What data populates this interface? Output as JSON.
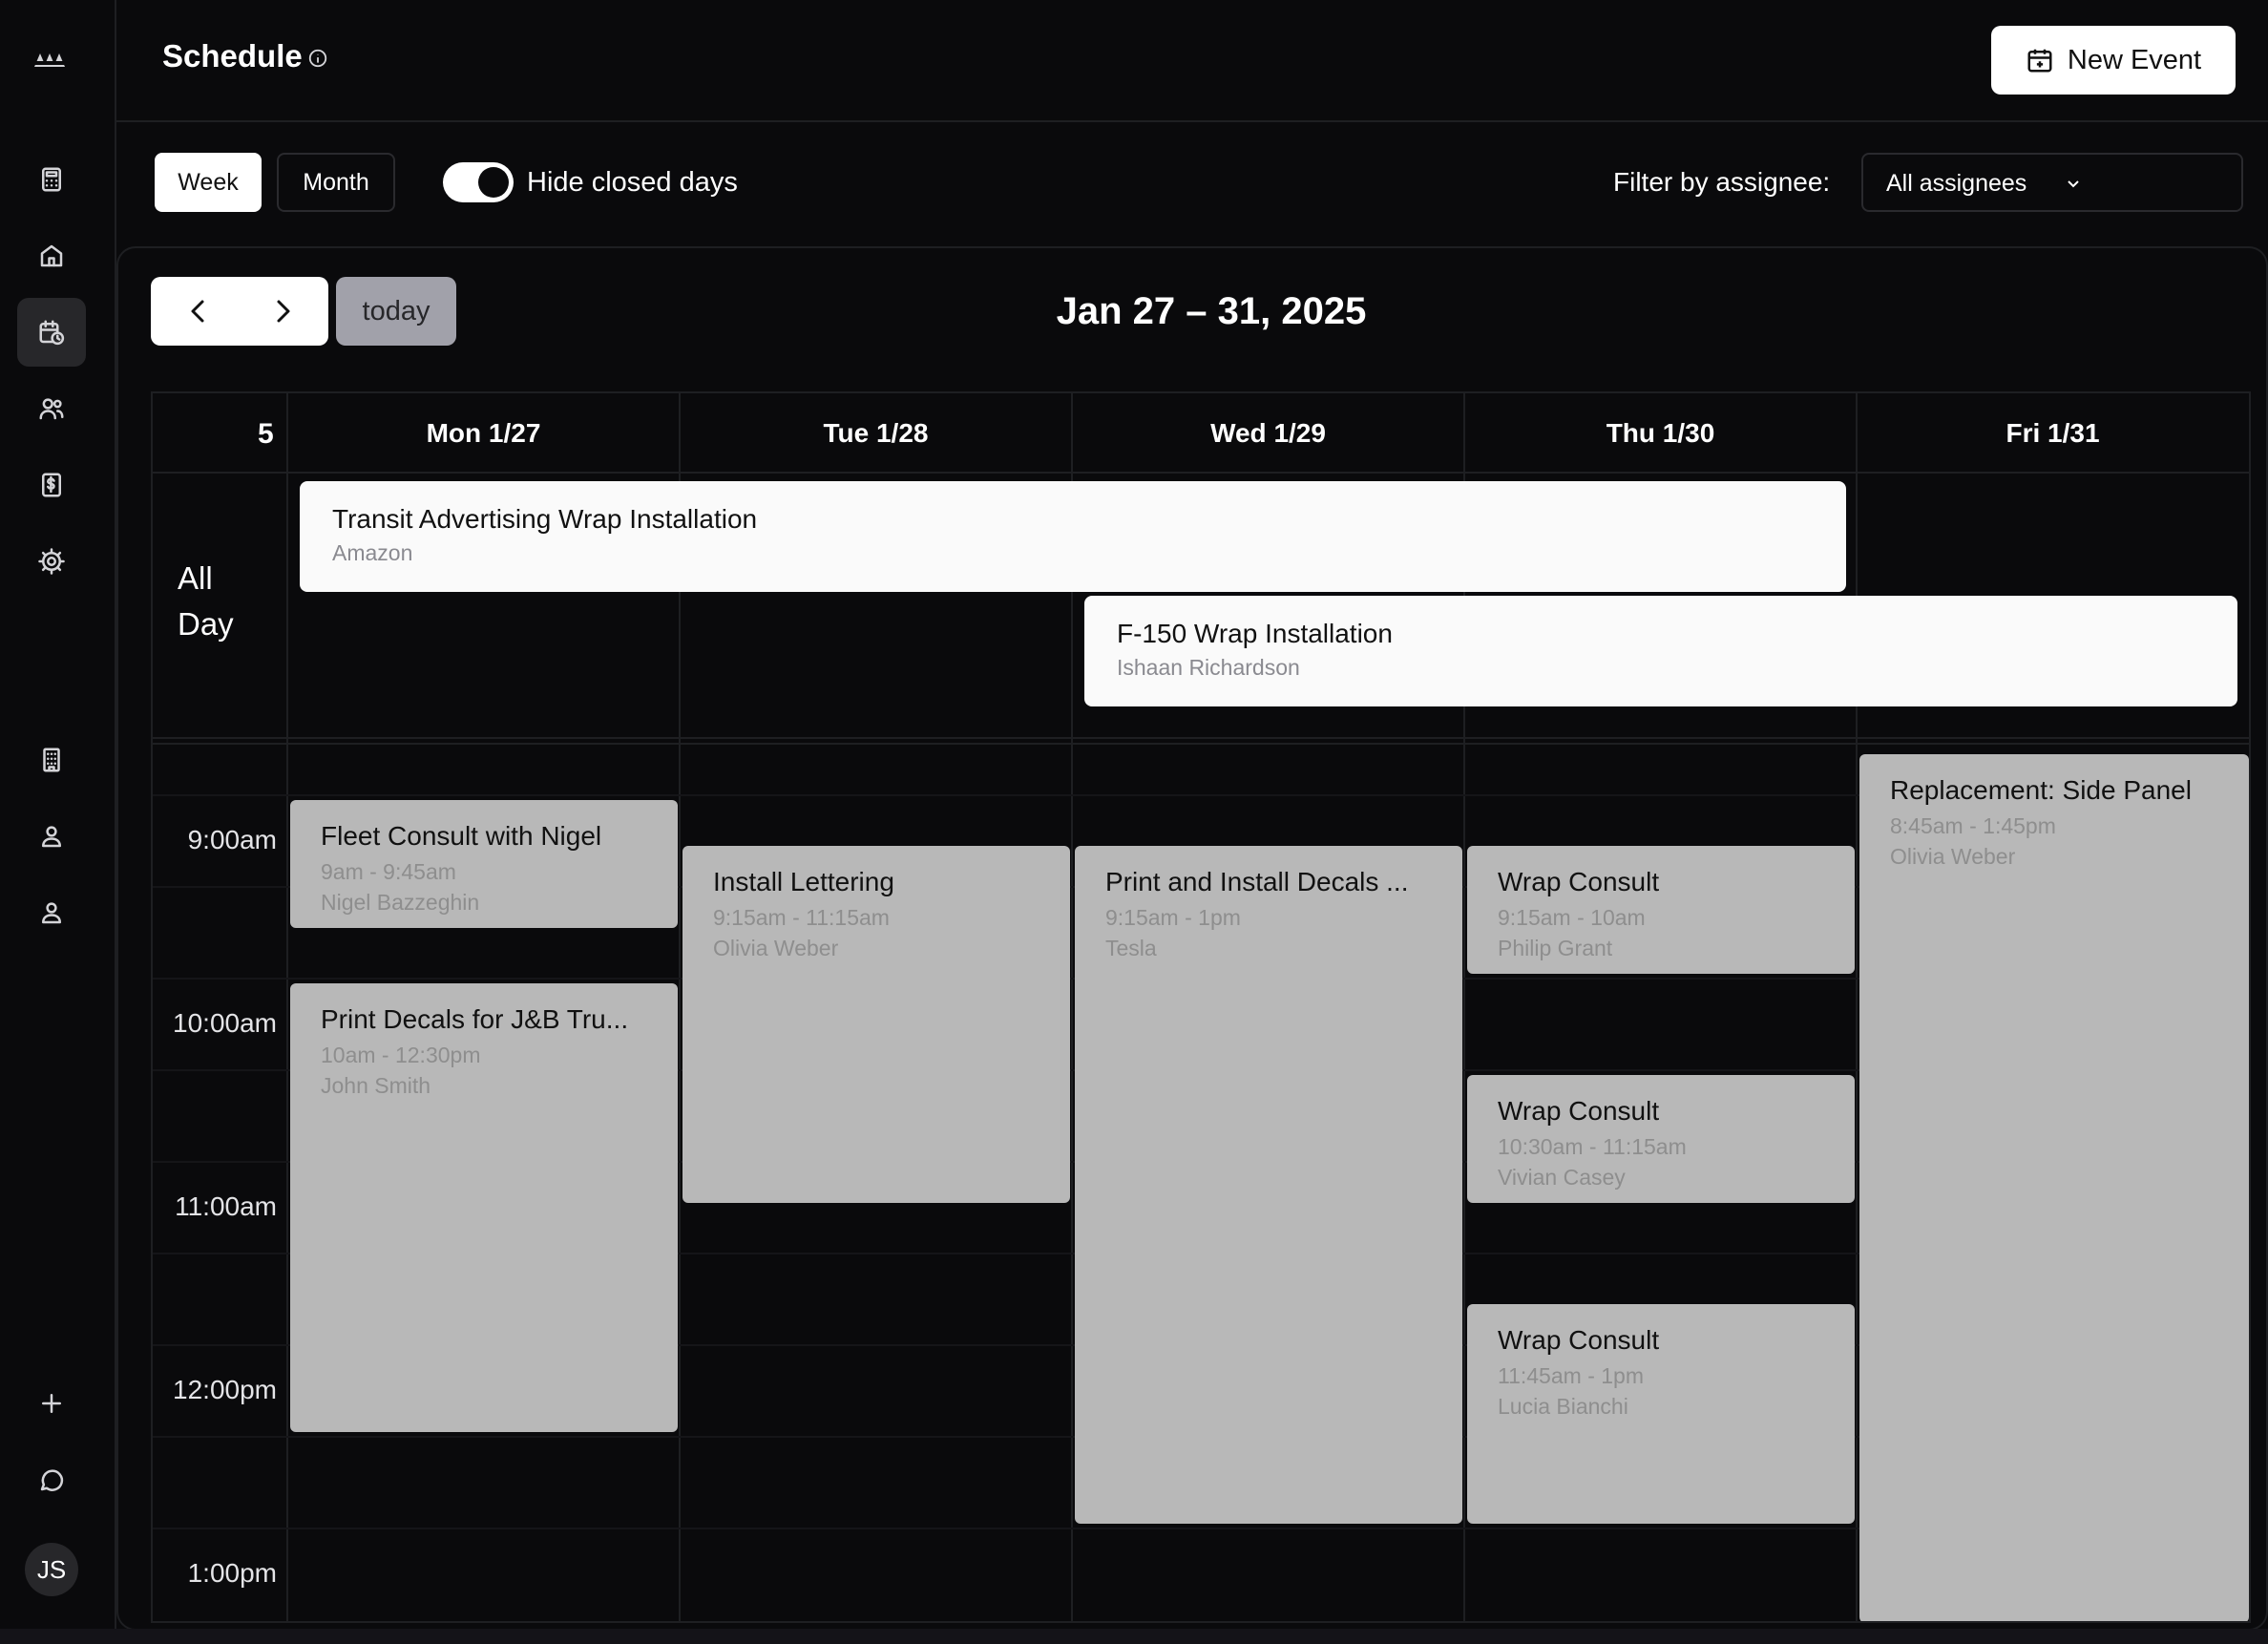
{
  "header": {
    "title": "Schedule",
    "new_event_label": "New Event"
  },
  "sidebar": {
    "items": [
      {
        "name": "calculator-icon"
      },
      {
        "name": "home-icon"
      },
      {
        "name": "calendar-clock-icon",
        "active": true
      },
      {
        "name": "users-icon"
      },
      {
        "name": "invoice-icon"
      },
      {
        "name": "settings-icon"
      },
      {
        "name": "building-icon"
      },
      {
        "name": "user-icon"
      },
      {
        "name": "user-icon"
      },
      {
        "name": "plus-icon"
      },
      {
        "name": "chat-icon"
      }
    ],
    "avatar_initials": "JS"
  },
  "toolbar": {
    "view_week": "Week",
    "view_month": "Month",
    "active_view": "Week",
    "hide_closed_days_label": "Hide closed days",
    "hide_closed_days_on": true,
    "filter_label": "Filter by assignee:",
    "assignee_value": "All assignees"
  },
  "calendar": {
    "today_label": "today",
    "range_title": "Jan 27 – 31, 2025",
    "week_number": "5",
    "allday_label_line1": "All",
    "allday_label_line2": "Day",
    "days": [
      "Mon 1/27",
      "Tue 1/28",
      "Wed 1/29",
      "Thu 1/30",
      "Fri 1/31"
    ],
    "time_labels": [
      "9:00am",
      "10:00am",
      "11:00am",
      "12:00pm",
      "1:00pm"
    ],
    "allday_events": [
      {
        "title": "Transit Advertising Wrap Installation",
        "subtitle": "Amazon"
      },
      {
        "title": "F-150 Wrap Installation",
        "subtitle": "Ishaan Richardson"
      }
    ],
    "events": [
      {
        "title": "Fleet Consult with Nigel",
        "time": "9am - 9:45am",
        "assignee": "Nigel Bazzeghin"
      },
      {
        "title": "Print Decals for J&B Tru...",
        "time": "10am - 12:30pm",
        "assignee": "John Smith"
      },
      {
        "title": "Install Lettering",
        "time": "9:15am - 11:15am",
        "assignee": "Olivia Weber"
      },
      {
        "title": "Print and Install Decals ...",
        "time": "9:15am - 1pm",
        "assignee": "Tesla"
      },
      {
        "title": "Wrap Consult",
        "time": "9:15am - 10am",
        "assignee": "Philip Grant"
      },
      {
        "title": "Wrap Consult",
        "time": "10:30am - 11:15am",
        "assignee": "Vivian Casey"
      },
      {
        "title": "Wrap Consult",
        "time": "11:45am - 1pm",
        "assignee": "Lucia Bianchi"
      },
      {
        "title": "Replacement: Side Panel",
        "time": "8:45am - 1:45pm",
        "assignee": "Olivia Weber"
      }
    ]
  }
}
